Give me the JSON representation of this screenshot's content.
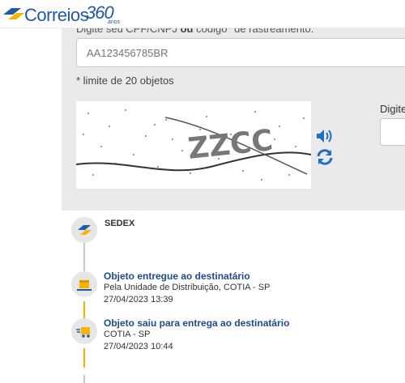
{
  "header": {
    "logo_text": "Correios",
    "logo_360": "360",
    "logo_anos": "anos"
  },
  "form": {
    "instruction_prefix": "Digite seu CPF/CNPJ",
    "instruction_bold": "ou",
    "instruction_suffix": "código* de rastreamento.",
    "tracking_placeholder": "AA123456785BR",
    "limit_note": "* limite de 20 objetos",
    "captcha_text": "ZZCC",
    "captcha_label": "Digite",
    "icons": [
      "audio-icon",
      "refresh-icon"
    ],
    "accent_color": "#1f6fc0"
  },
  "tracking": {
    "service": "SEDEX",
    "events": [
      {
        "title": "Objeto entregue ao destinatário",
        "location": "Pela Unidade de Distribuição, COTIA - SP",
        "datetime": "27/04/2023 13:39",
        "icon": "delivered-package-icon"
      },
      {
        "title": "Objeto saiu para entrega ao destinatário",
        "location": "COTIA - SP",
        "datetime": "27/04/2023 10:44",
        "icon": "delivery-truck-icon"
      }
    ],
    "line_colors": {
      "pending": "#c8c8c8",
      "active": "#f5b400"
    }
  }
}
